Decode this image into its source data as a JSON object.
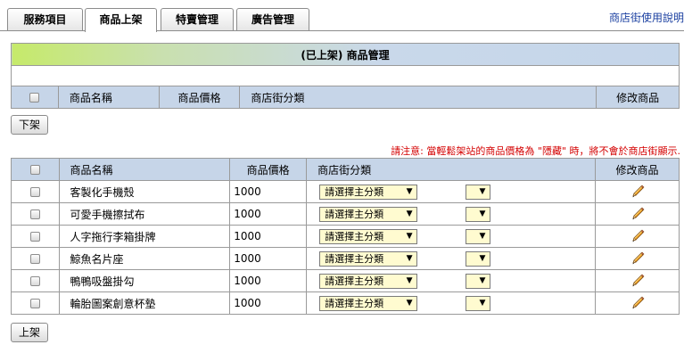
{
  "tabs": [
    {
      "label": "服務項目",
      "active": false
    },
    {
      "label": "商品上架",
      "active": true
    },
    {
      "label": "特賣管理",
      "active": false
    },
    {
      "label": "廣告管理",
      "active": false
    }
  ],
  "help_link": "商店街使用說明",
  "listed": {
    "title": "(已上架) 商品管理",
    "columns": [
      "商品名稱",
      "商品價格",
      "商店街分類",
      "修改商品"
    ],
    "button": "下架"
  },
  "notice": "請注意: 當輕鬆架站的商品價格為 \"隱藏\" 時，將不會於商店街顯示.",
  "unlisted": {
    "columns": [
      "商品名稱",
      "商品價格",
      "商店街分類",
      "修改商品"
    ],
    "select_placeholder": "請選擇主分類",
    "rows": [
      {
        "name": "客製化手機殼",
        "price": "1000"
      },
      {
        "name": "可愛手機擦拭布",
        "price": "1000"
      },
      {
        "name": "人字拖行李箱掛牌",
        "price": "1000"
      },
      {
        "name": "鯨魚名片座",
        "price": "1000"
      },
      {
        "name": "鴨鴨吸盤掛勾",
        "price": "1000"
      },
      {
        "name": "輪胎圖案創意杯墊",
        "price": "1000"
      }
    ],
    "button": "上架"
  },
  "colors": {
    "header_bg": "#c6d5e8",
    "select_bg": "#fffbd0",
    "notice": "#d40000",
    "link": "#1a3fa0"
  },
  "icons": {
    "edit": "pencil-icon",
    "dropdown": "chevron-down-icon"
  }
}
